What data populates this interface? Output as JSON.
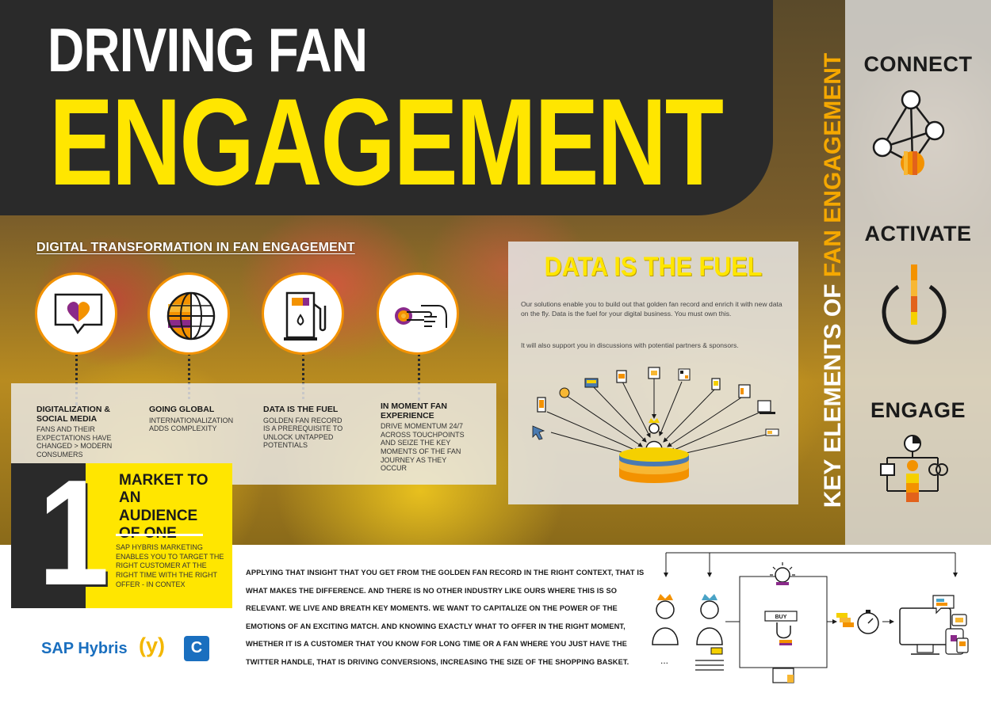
{
  "header": {
    "title_line1": "DRIVING FAN",
    "title_line2": "ENGAGEMENT"
  },
  "side": {
    "vertical_title_white": "KEY ELEMENTS OF ",
    "vertical_title_yellow": "FAN ENGAGEMENT",
    "connect": "CONNECT",
    "activate": "ACTIVATE",
    "engage": "ENGAGE"
  },
  "digital": {
    "title": "DIGITAL TRANSFORMATION IN FAN ENGAGEMENT",
    "items": [
      {
        "title": "DIGITALIZATION & SOCIAL MEDIA",
        "text": "FANS AND THEIR EXPECTATIONS HAVE CHANGED > MODERN CONSUMERS"
      },
      {
        "title": "GOING GLOBAL",
        "text": "INTERNATIONALIZATION ADDS COMPLEXITY"
      },
      {
        "title": "DATA IS THE FUEL",
        "text": "GOLDEN FAN RECORD IS A PREREQUISITE TO UNLOCK UNTAPPED POTENTIALS"
      },
      {
        "title": "IN MOMENT FAN EXPERIENCE",
        "text": "DRIVE MOMENTUM 24/7 ACROSS TOUCHPOINTS AND SEIZE THE KEY MOMENTS OF THE FAN JOURNEY AS THEY OCCUR"
      }
    ]
  },
  "fuel": {
    "title": "DATA IS THE FUEL",
    "para1": "Our solutions enable you to build out that golden fan record and enrich it with new data on the fly. Data is the fuel for your digital business. You must own this.",
    "para2": "It will also support you in discussions with potential partners & sponsors."
  },
  "market": {
    "number": "1",
    "title": "MARKET TO AN AUDIENCE OF ONE",
    "text": "SAP HYBRIS MARKETING ENABLES YOU TO TARGET THE RIGHT CUSTOMER AT THE RIGHT TIME WITH THE RIGHT OFFER - IN CONTEX"
  },
  "bottom": {
    "text": "APPLYING THAT INSIGHT THAT YOU GET FROM THE GOLDEN FAN RECORD IN THE RIGHT CONTEXT, THAT IS WHAT MAKES THE DIFFERENCE. AND THERE IS NO OTHER INDUSTRY LIKE OURS WHERE THIS IS SO RELEVANT. WE LIVE AND BREATH KEY MOMENTS. WE WANT TO CAPITALIZE ON THE POWER OF THE EMOTIONS OF AN EXCITING MATCH. AND KNOWING EXACTLY WHAT TO OFFER IN THE RIGHT MOMENT, WHETHER IT IS A CUSTOMER THAT YOU KNOW FOR LONG TIME OR A FAN WHERE YOU JUST HAVE THE TWITTER HANDLE, THAT IS DRIVING CONVERSIONS, INCREASING THE SIZE OF THE SHOPPING BASKET.",
    "buy_label": "BUY",
    "dots": "..."
  },
  "logos": {
    "sap": "SAP Hybris",
    "bracket": "(y)",
    "partner": "C"
  },
  "colors": {
    "dark": "#2a2a2a",
    "yellow": "#ffe600",
    "orange": "#f39200",
    "purple": "#8a2a8a"
  }
}
